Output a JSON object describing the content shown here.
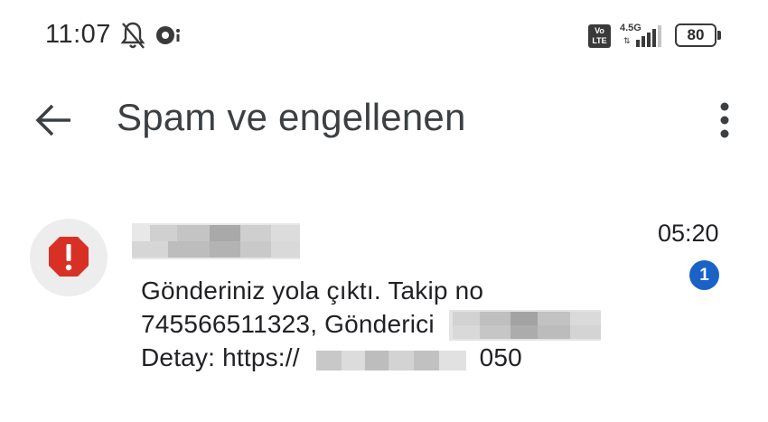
{
  "status_bar": {
    "time": "11:07",
    "network_badge": "Vo LTE",
    "network_type": "4.5G",
    "battery_level": "80"
  },
  "app_bar": {
    "title": "Spam ve engellenen"
  },
  "conversation": {
    "timestamp": "05:20",
    "unread_count": "1",
    "message_line1": "Gönderiniz yola çıktı. Takip no",
    "message_line2": "745566511323, Gönderici",
    "message_line3_prefix": "Detay: https://",
    "message_line3_suffix": "B050"
  },
  "colors": {
    "avatar_alert": "#d93025",
    "unread_badge": "#1a62c6"
  }
}
